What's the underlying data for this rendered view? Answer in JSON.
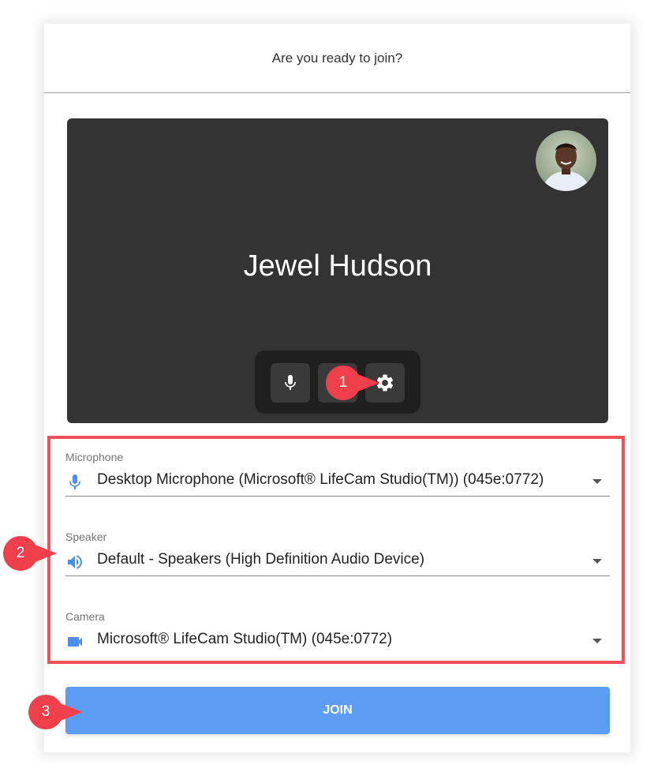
{
  "header": {
    "title": "Are you ready to join?"
  },
  "preview": {
    "participant_name": "Jewel Hudson",
    "controls": [
      "microphone-icon",
      "camera-icon",
      "gear-icon"
    ]
  },
  "devices": {
    "microphone": {
      "label": "Microphone",
      "value": "Desktop Microphone (Microsoft® LifeCam Studio(TM)) (045e:0772)",
      "icon": "microphone-icon"
    },
    "speaker": {
      "label": "Speaker",
      "value": "Default - Speakers (High Definition Audio Device)",
      "icon": "speaker-icon"
    },
    "camera": {
      "label": "Camera",
      "value": "Microsoft® LifeCam Studio(TM) (045e:0772)",
      "icon": "camera-icon"
    }
  },
  "join_button": {
    "label": "JOIN"
  },
  "callouts": [
    "1",
    "2",
    "3"
  ],
  "colors": {
    "accent": "#5c9cf3",
    "icon_blue": "#4a8ef0",
    "preview_bg": "#333333",
    "highlight": "#f05057",
    "callout": "#ef3f4a"
  }
}
